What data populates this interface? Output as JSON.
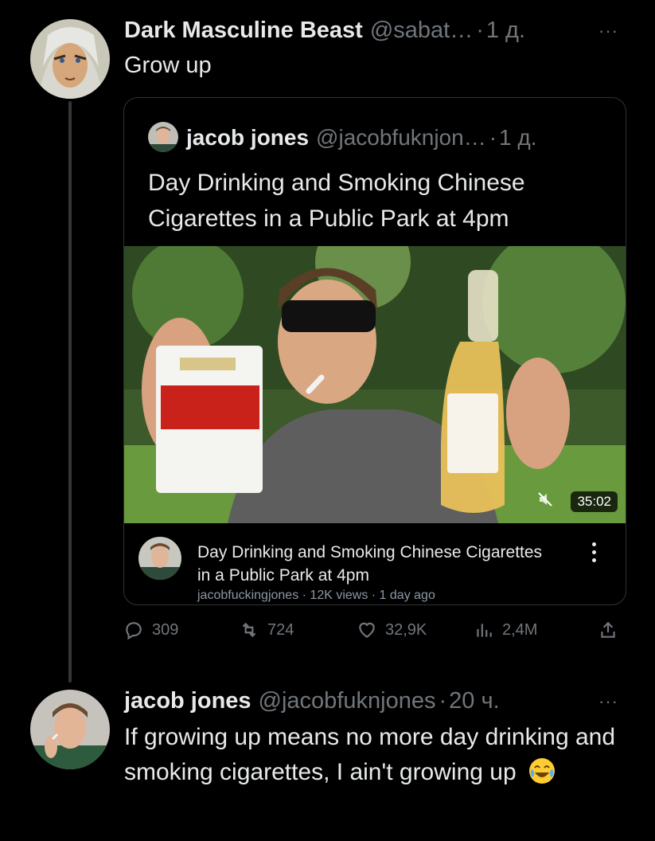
{
  "parent_post": {
    "author_name": "Dark Masculine Beast",
    "author_handle": "@sabat…",
    "sep": "·",
    "time": "1 д.",
    "text": "Grow up",
    "more_label": "···"
  },
  "quoted_post": {
    "author_name": "jacob jones",
    "author_handle": "@jacobfuknjon…",
    "sep": "·",
    "time": "1 д.",
    "text": "Day Drinking and Smoking Chinese Cigarettes in a Public Park at 4pm",
    "video": {
      "duration": "35:02",
      "title": "Day Drinking and Smoking Chinese Cigarettes in a Public Park at 4pm",
      "meta": "jacobfuckingjones · 12K views · 1 day ago"
    }
  },
  "actions": {
    "replies": "309",
    "reposts": "724",
    "likes": "32,9K",
    "views": "2,4M"
  },
  "reply_post": {
    "author_name": "jacob jones",
    "author_handle": "@jacobfuknjones",
    "sep": "·",
    "time": "20 ч.",
    "text": "If growing up means no more day drinking and smoking cigarettes, I ain't growing up",
    "emoji_icon": "joy-emoji-icon",
    "more_label": "···"
  },
  "colors": {
    "background": "#000000",
    "text": "#e7e9ea",
    "muted": "#71767b",
    "border": "#2f3336"
  }
}
